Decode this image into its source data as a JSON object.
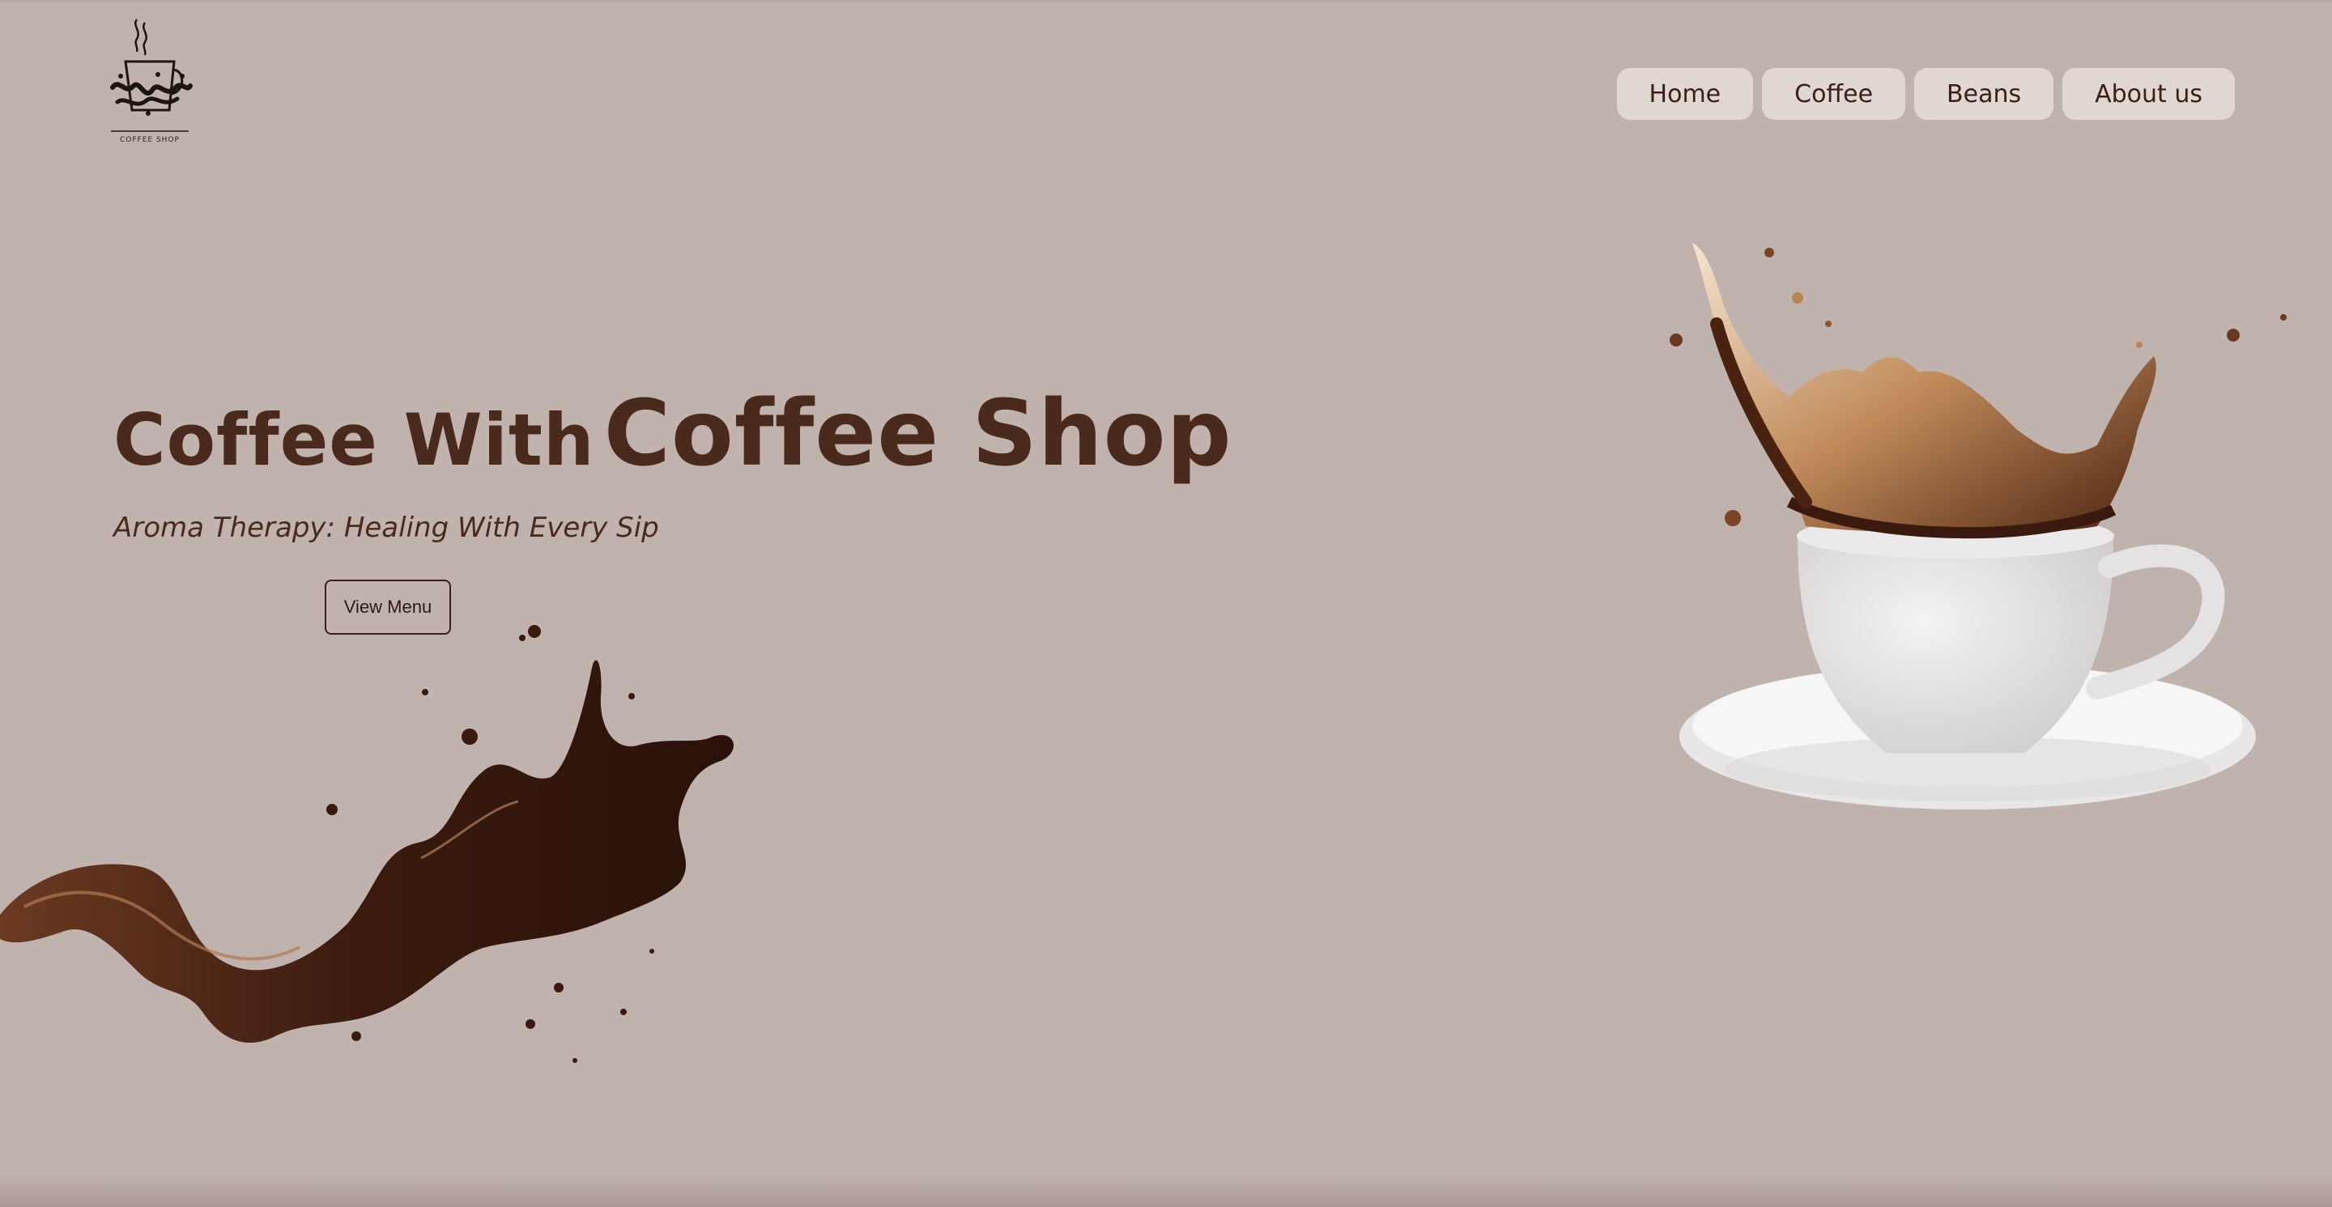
{
  "logo": {
    "caption": "COFFEE SHOP",
    "icon": "coffee-cup-logo-icon"
  },
  "nav": {
    "items": [
      {
        "label": "Home"
      },
      {
        "label": "Coffee"
      },
      {
        "label": "Beans"
      },
      {
        "label": "About us"
      }
    ]
  },
  "hero": {
    "title_part1": "Coffee With",
    "title_part2": "Coffee Shop",
    "subtitle": "Aroma Therapy: Healing With Every Sip",
    "cta_label": "View Menu"
  },
  "images": {
    "left": "coffee-splash-image",
    "right": "coffee-cup-splash-image"
  },
  "colors": {
    "background": "#c0b2ad",
    "nav_button": "#e0d6d2",
    "heading": "#4a2a1c",
    "coffee": "#3d1f12"
  }
}
